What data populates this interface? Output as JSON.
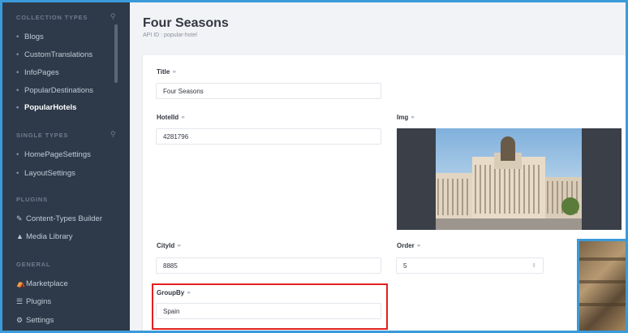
{
  "sidebar": {
    "collection_types": {
      "heading": "COLLECTION TYPES",
      "items": [
        {
          "label": "Blogs"
        },
        {
          "label": "CustomTranslations"
        },
        {
          "label": "InfoPages"
        },
        {
          "label": "PopularDestinations"
        },
        {
          "label": "PopularHotels",
          "active": true
        }
      ]
    },
    "single_types": {
      "heading": "SINGLE TYPES",
      "items": [
        {
          "label": "HomePageSettings"
        },
        {
          "label": "LayoutSettings"
        }
      ]
    },
    "plugins": {
      "heading": "PLUGINS",
      "items": [
        {
          "label": "Content-Types Builder",
          "icon": "pencil-icon"
        },
        {
          "label": "Media Library",
          "icon": "image-icon"
        }
      ]
    },
    "general": {
      "heading": "GENERAL",
      "items": [
        {
          "label": "Marketplace",
          "icon": "shop-icon"
        },
        {
          "label": "Plugins",
          "icon": "list-icon"
        },
        {
          "label": "Settings",
          "icon": "gear-icon"
        }
      ]
    }
  },
  "header": {
    "title": "Four Seasons",
    "api_id": "API ID : popular-hotel"
  },
  "form": {
    "title": {
      "label": "Title",
      "value": "Four Seasons"
    },
    "hotel_id": {
      "label": "HotelId",
      "value": "4281796"
    },
    "img": {
      "label": "Img"
    },
    "city_id": {
      "label": "CityId",
      "value": "8885"
    },
    "order": {
      "label": "Order",
      "value": "5"
    },
    "group_by": {
      "label": "GroupBy",
      "value": "Spain"
    }
  },
  "colors": {
    "accent": "#3b9ad9",
    "sidebar_bg": "#2e3a49",
    "highlight": "#e02020"
  }
}
